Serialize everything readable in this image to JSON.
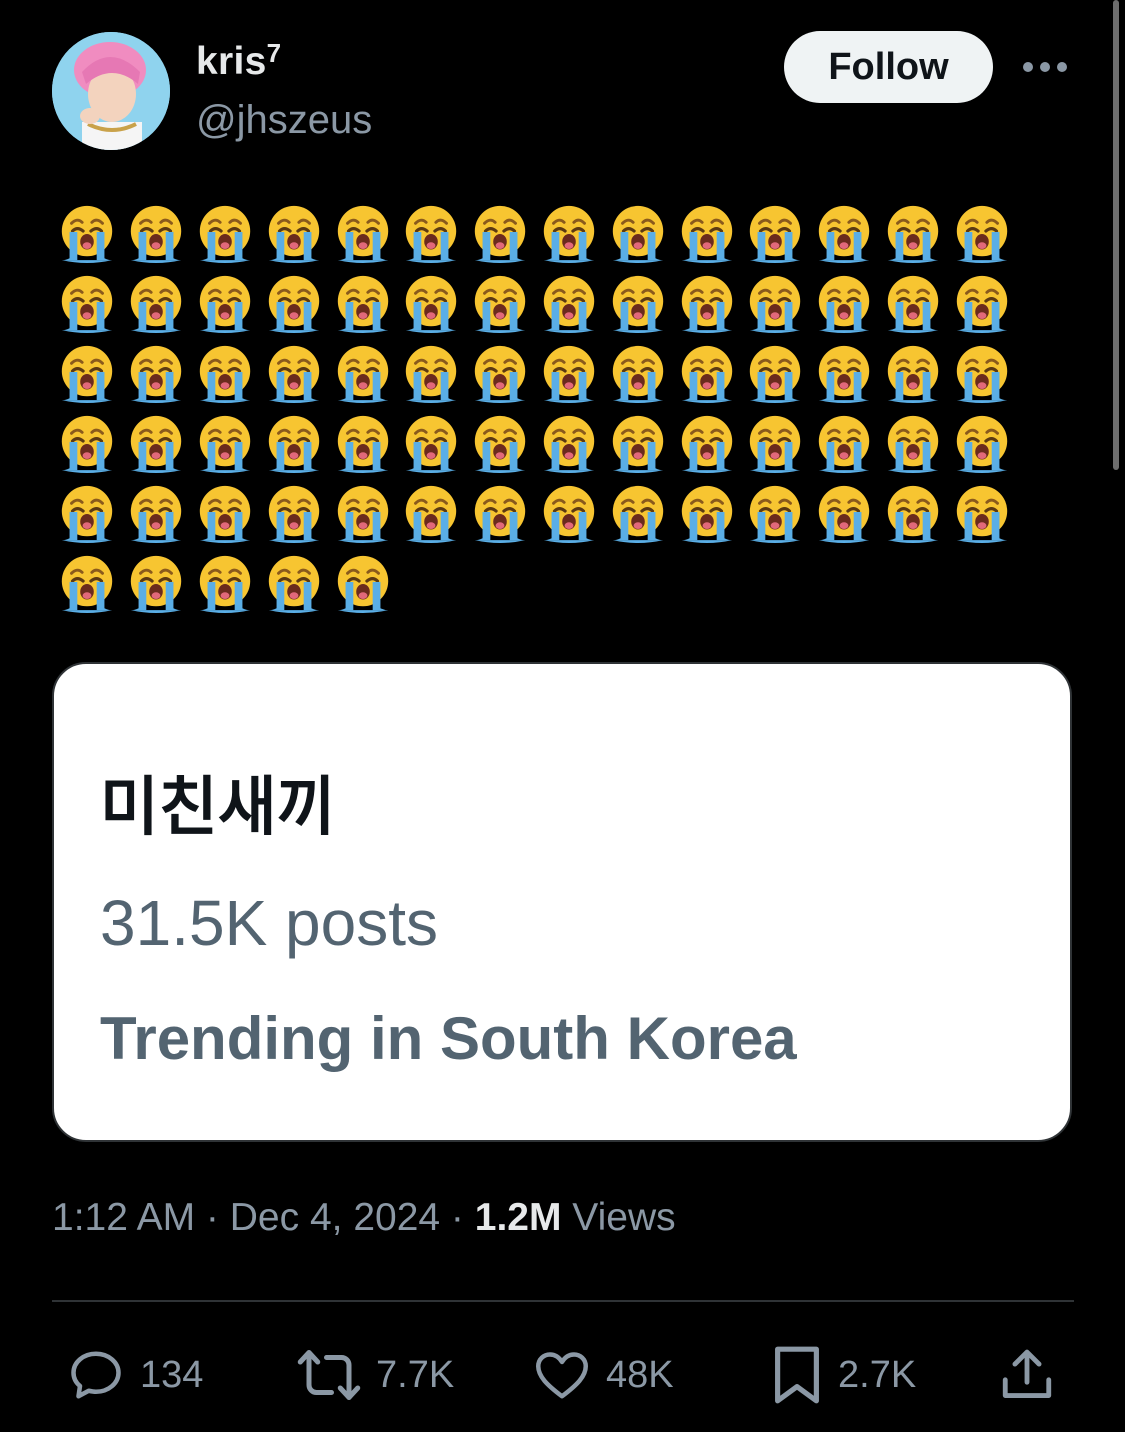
{
  "user": {
    "display_name": "kris",
    "display_name_suffix": "7",
    "handle": "@jhszeus"
  },
  "follow_label": "Follow",
  "tweet": {
    "emoji_symbol": "loudly-crying-face",
    "emoji_count": 75,
    "emoji_rows": [
      14,
      14,
      14,
      14,
      14,
      5
    ]
  },
  "card": {
    "topic": "미친새끼",
    "post_count": "31.5K posts",
    "trend_location": "Trending in South Korea"
  },
  "meta": {
    "time": "1:12 AM",
    "separator": " · ",
    "date": "Dec 4, 2024",
    "views_count": "1.2M",
    "views_label": " Views"
  },
  "actions": {
    "replies": "134",
    "reposts": "7.7K",
    "likes": "48K",
    "bookmarks": "2.7K"
  },
  "icons": {
    "reply": "speech-bubble-icon",
    "repost": "repost-arrows-icon",
    "like": "heart-icon",
    "bookmark": "bookmark-icon",
    "share": "share-upload-icon",
    "more": "ellipsis-icon"
  },
  "colors": {
    "background": "#000000",
    "primary_text": "#e7e9ea",
    "secondary_text": "#8b98a5",
    "follow_bg": "#eff3f4",
    "card_bg": "#ffffff",
    "emoji_face": "#f7c531",
    "emoji_tears": "#5aaee6"
  }
}
